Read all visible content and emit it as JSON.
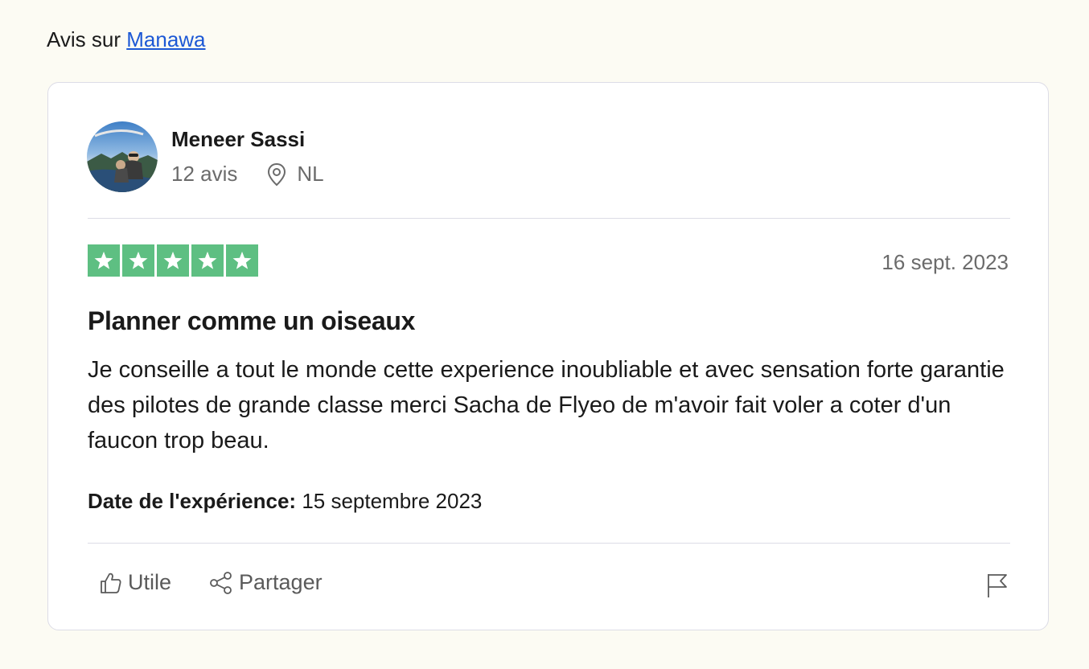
{
  "header": {
    "prefix": "Avis sur",
    "company_link": "Manawa"
  },
  "reviewer": {
    "name": "Meneer Sassi",
    "review_count": "12 avis",
    "country": "NL",
    "location_icon": "location-pin-icon"
  },
  "review": {
    "rating": 5,
    "rating_max": 5,
    "star_color": "#5ebf82",
    "date": "16 sept. 2023",
    "title": "Planner comme un oiseaux",
    "body": "Je conseille a tout le monde cette experience inoubliable et avec sensation forte garantie des pilotes de grande classe merci Sacha de Flyeo de m'avoir fait voler a coter d'un faucon trop beau.",
    "experience_label": "Date de l'expérience:",
    "experience_date": "15 septembre 2023"
  },
  "actions": {
    "useful_label": "Utile",
    "share_label": "Partager",
    "useful_icon": "thumbs-up-icon",
    "share_icon": "share-icon",
    "report_icon": "flag-icon"
  },
  "colors": {
    "link": "#1c58d5",
    "background": "#fcfbf3",
    "muted_text": "#6b6b6b"
  }
}
